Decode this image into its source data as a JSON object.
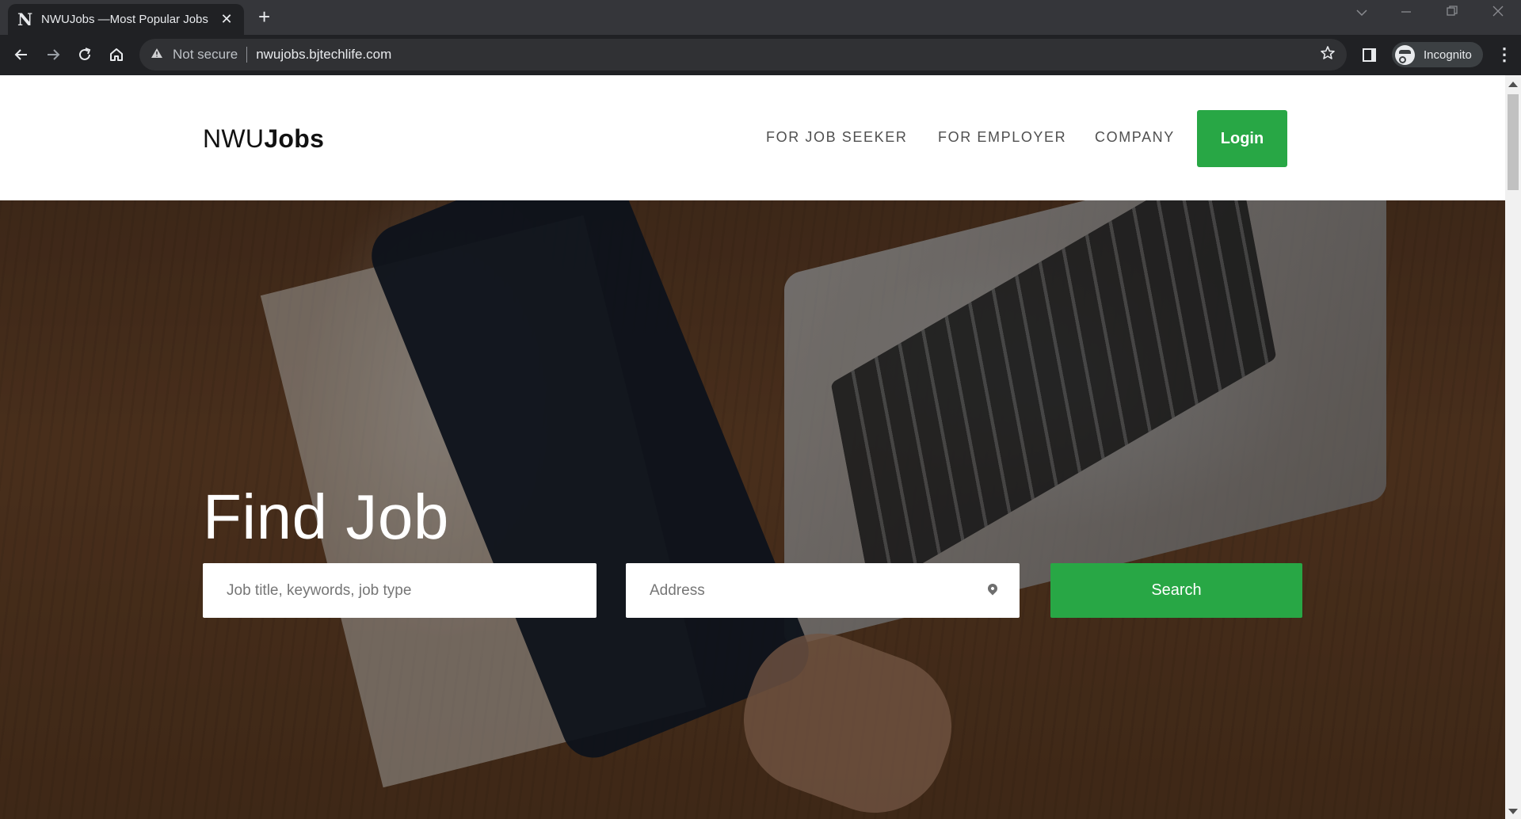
{
  "browser": {
    "tab_title": "NWUJobs —Most Popular Jobs",
    "tab_favicon": "N",
    "new_tab_glyph": "+",
    "close_glyph": "✕",
    "security_label": "Not secure",
    "url": "nwujobs.bjtechlife.com",
    "profile_label": "Incognito",
    "icons": [
      "back-icon",
      "forward-icon",
      "reload-icon",
      "home-icon",
      "warning-icon",
      "star-icon",
      "side-panel-icon",
      "incognito-icon",
      "more-icon"
    ]
  },
  "site": {
    "logo_light": "NWU",
    "logo_bold": "Jobs",
    "nav": {
      "job_seeker": "FOR JOB SEEKER",
      "employer": "FOR EMPLOYER",
      "company": "COMPANY"
    },
    "login_label": "Login"
  },
  "hero": {
    "title": "Find Job",
    "keyword_placeholder": "Job title, keywords, job type",
    "address_placeholder": "Address",
    "search_label": "Search"
  },
  "colors": {
    "accent_green": "#28a745",
    "chrome_dark": "#202124",
    "chrome_tabstrip": "#35363a"
  }
}
